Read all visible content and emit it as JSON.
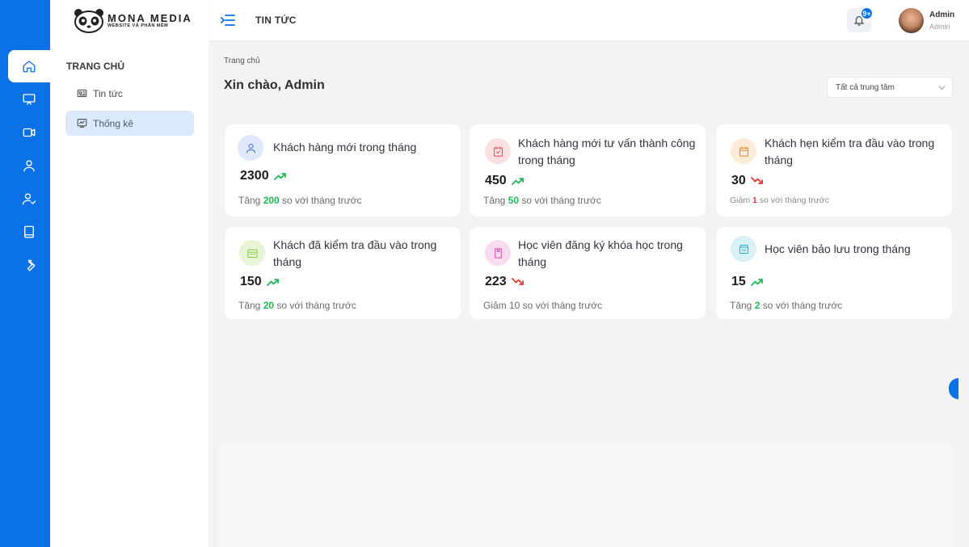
{
  "brand": {
    "title": "MONA MEDIA",
    "subtitle": "WEBSITE VÀ PHẦN MỀM"
  },
  "rail": {
    "items": [
      "home-icon",
      "presentation-icon",
      "video-icon",
      "user-icon",
      "user-check-icon",
      "book-icon",
      "wrench-icon"
    ],
    "active": 0
  },
  "sidebar": {
    "section_title": "TRANG CHỦ",
    "items": [
      {
        "label": "Tin tức",
        "icon": "news-icon",
        "active": false
      },
      {
        "label": "Thống kê",
        "icon": "stats-icon",
        "active": true
      }
    ]
  },
  "header": {
    "title": "TIN TỨC",
    "notification_badge": "9+",
    "user_name": "Admin",
    "user_role": "Admin"
  },
  "main": {
    "breadcrumb": "Trang chủ",
    "greeting": "Xin chào, Admin",
    "center_select": "Tất cả trung tâm"
  },
  "cards": [
    {
      "title": "Khách hàng mới trong tháng",
      "value": "2300",
      "trend": "up",
      "foot_prefix": "Tăng ",
      "foot_value": "200",
      "foot_suffix": " so với tháng trước",
      "icon": "user-icon",
      "accent": "#2f6fe0",
      "icon_bg": "#dfe9fb"
    },
    {
      "title": "Khách hàng mới tư vấn thành công trong tháng",
      "value": "450",
      "trend": "up",
      "foot_prefix": "Tăng ",
      "foot_value": "50",
      "foot_suffix": " so với tháng trước",
      "icon": "calendar-check-icon",
      "accent": "#e0485d",
      "icon_bg": "#fbdfe3"
    },
    {
      "title": "Khách hẹn kiểm tra đầu vào trong tháng",
      "value": "30",
      "trend": "down",
      "foot_prefix": "Giảm ",
      "foot_value": "1",
      "foot_suffix": " so với tháng trước",
      "icon": "calendar-icon",
      "accent": "#e38a2c",
      "icon_bg": "#fcebd6"
    },
    {
      "title": "Khách đã kiểm tra đầu vào trong tháng",
      "value": "150",
      "trend": "up",
      "foot_prefix": "Tăng ",
      "foot_value": "20",
      "foot_suffix": " so với tháng trước",
      "icon": "calendar-dots-icon",
      "accent": "#8bc34a",
      "icon_bg": "#e6f5d6"
    },
    {
      "title": "Học viên đăng ký khóa học trong tháng",
      "value": "223",
      "trend": "down",
      "foot_prefix": "Giảm 10 so với tháng trước",
      "foot_value": "",
      "foot_suffix": "",
      "icon": "bookmark-icon",
      "accent": "#d946a8",
      "icon_bg": "#f8dbef"
    },
    {
      "title": "Học viên bảo lưu trong tháng",
      "value": "15",
      "trend": "up",
      "foot_prefix": "Tăng ",
      "foot_value": "2",
      "foot_suffix": " so với tháng trước",
      "icon": "archive-icon",
      "accent": "#2bb3c9",
      "icon_bg": "#d7f1f6"
    }
  ]
}
